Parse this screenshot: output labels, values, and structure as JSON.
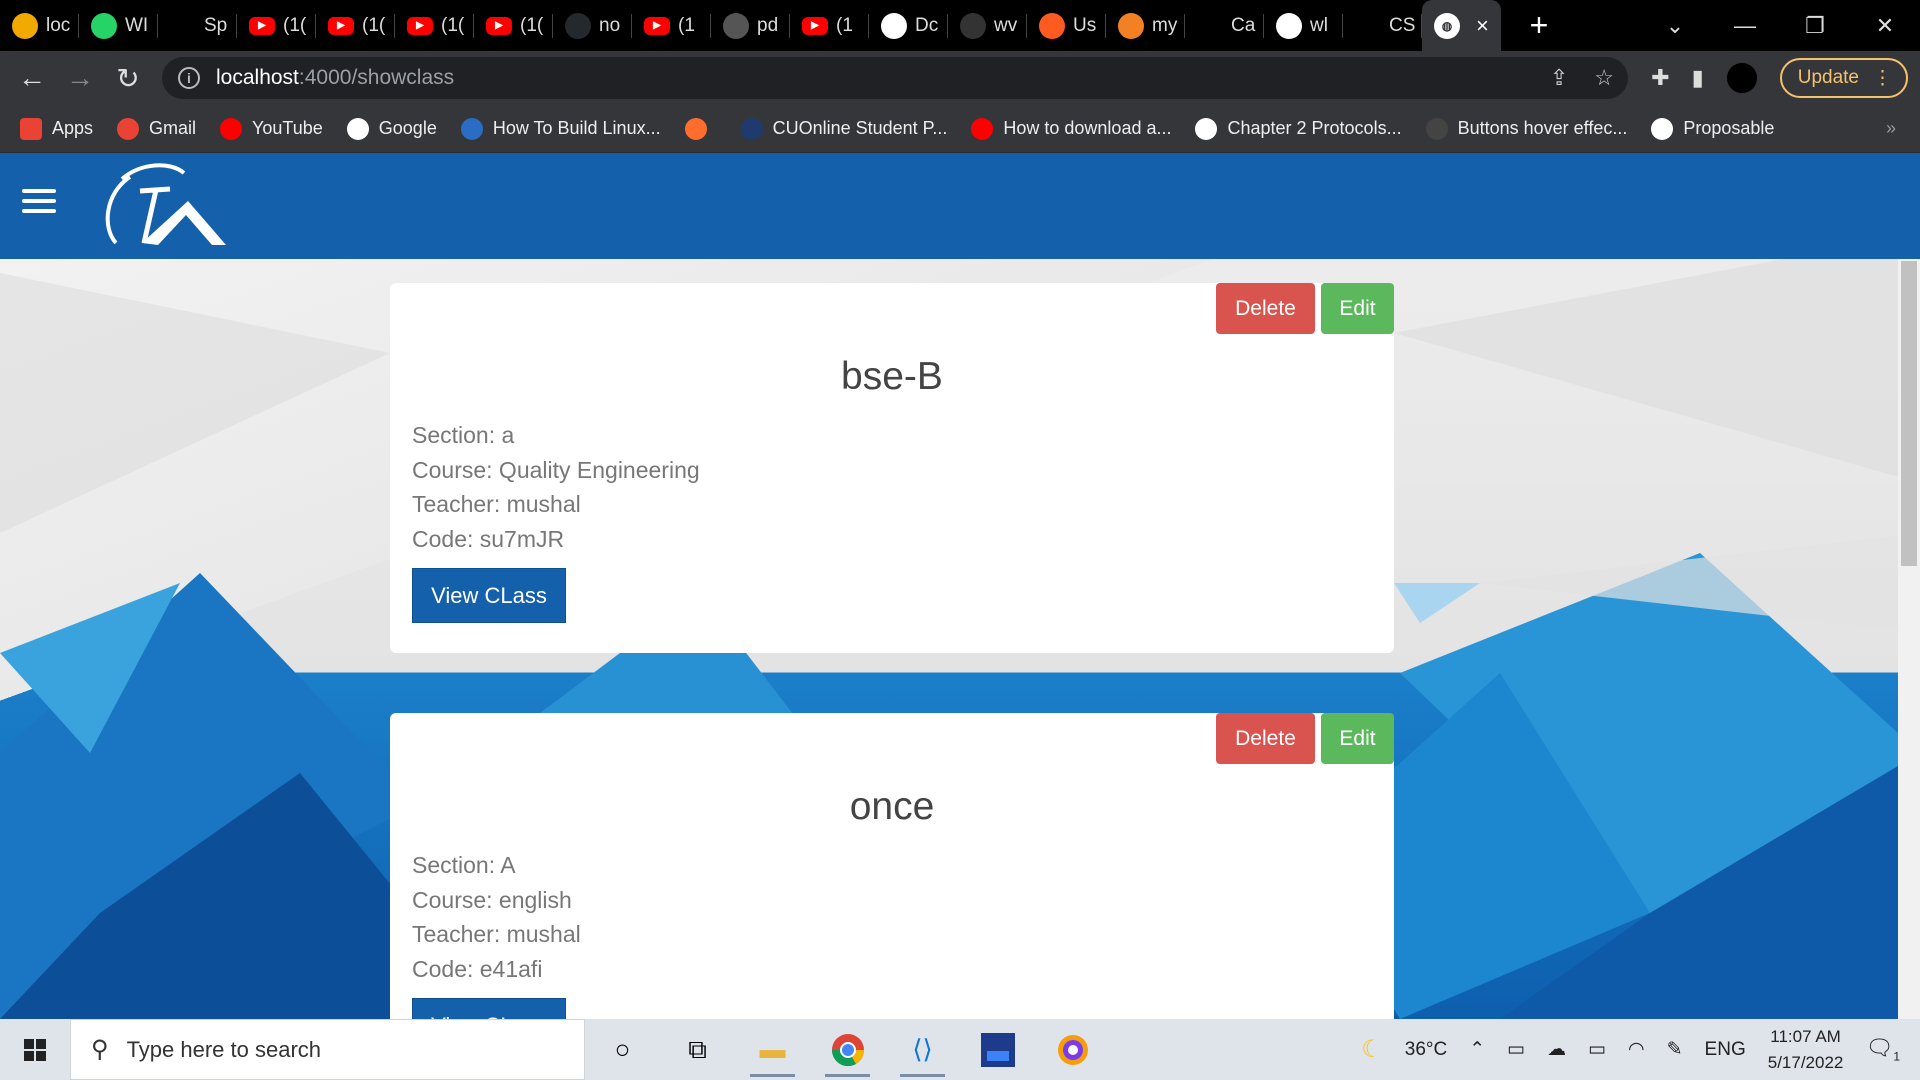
{
  "browser": {
    "tabs": [
      {
        "label": "loc",
        "icon": "app-icon",
        "color": "#f2a900"
      },
      {
        "label": "WI",
        "icon": "whatsapp-icon",
        "color": "#25d366"
      },
      {
        "label": "Sp",
        "icon": "codepen-icon",
        "color": "#000000"
      },
      {
        "label": "(1(",
        "icon": "youtube-icon",
        "color": "#ff0000"
      },
      {
        "label": "(1(",
        "icon": "youtube-icon",
        "color": "#ff0000"
      },
      {
        "label": "(1(",
        "icon": "youtube-icon",
        "color": "#ff0000"
      },
      {
        "label": "(1(",
        "icon": "youtube-icon",
        "color": "#ff0000"
      },
      {
        "label": "no",
        "icon": "github-icon",
        "color": "#24292e"
      },
      {
        "label": "(1",
        "icon": "youtube-icon",
        "color": "#ff0000"
      },
      {
        "label": "pd",
        "icon": "globe-icon",
        "color": "#555555"
      },
      {
        "label": "(1",
        "icon": "youtube-icon",
        "color": "#ff0000"
      },
      {
        "label": "Dc",
        "icon": "doc-icon",
        "color": "#ffffff"
      },
      {
        "label": "wv",
        "icon": "site-icon",
        "color": "#333333"
      },
      {
        "label": "Us",
        "icon": "slash-icon",
        "color": "#ff5a1f"
      },
      {
        "label": "my",
        "icon": "stackoverflow-icon",
        "color": "#f48024"
      },
      {
        "label": "Ca",
        "icon": "codepen-icon",
        "color": "#000000"
      },
      {
        "label": "wl",
        "icon": "google-icon",
        "color": "#ffffff"
      },
      {
        "label": "CS",
        "icon": "codepen-icon",
        "color": "#000000"
      }
    ],
    "active_tab": {
      "icon": "globe-icon",
      "close": "×"
    },
    "new_tab": "+",
    "url_host": "localhost",
    "url_path": ":4000/showclass",
    "update_label": "Update"
  },
  "bookmarks": [
    {
      "label": "Apps",
      "icon": "apps-grid-icon",
      "color": "#ea4335"
    },
    {
      "label": "Gmail",
      "icon": "gmail-icon",
      "color": "#ea4335"
    },
    {
      "label": "YouTube",
      "icon": "youtube-icon",
      "color": "#ff0000"
    },
    {
      "label": "Google",
      "icon": "google-icon",
      "color": "#ffffff"
    },
    {
      "label": "How To Build Linux...",
      "icon": "globe-icon",
      "color": "#2b6cc4"
    },
    {
      "label": "",
      "icon": "bookmark-icon",
      "color": "#ff6d2e"
    },
    {
      "label": "CUOnline Student P...",
      "icon": "cu-icon",
      "color": "#1e3a6e"
    },
    {
      "label": "How to download a...",
      "icon": "youtube-icon",
      "color": "#ff0000"
    },
    {
      "label": "Chapter 2 Protocols...",
      "icon": "globe-icon",
      "color": "#ffffff"
    },
    {
      "label": "Buttons hover effec...",
      "icon": "circle-icon",
      "color": "#444444"
    },
    {
      "label": "Proposable",
      "icon": "globe-icon",
      "color": "#ffffff"
    }
  ],
  "bookmarks_more": "»",
  "classes": [
    {
      "title": "bse-B",
      "section": "Section: a",
      "course": "Course: Quality Engineering",
      "teacher": "Teacher: mushal",
      "code": "Code: su7mJR",
      "delete_label": "Delete",
      "edit_label": "Edit",
      "view_label": "View CLass"
    },
    {
      "title": "once",
      "section": "Section: A",
      "course": "Course: english",
      "teacher": "Teacher: mushal",
      "code": "Code: e41afi",
      "delete_label": "Delete",
      "edit_label": "Edit",
      "view_label": "View CLass"
    }
  ],
  "taskbar": {
    "search_placeholder": "Type here to search",
    "weather": "36°C",
    "language": "ENG",
    "time": "11:07 AM",
    "date": "5/17/2022",
    "notifications": "1"
  }
}
